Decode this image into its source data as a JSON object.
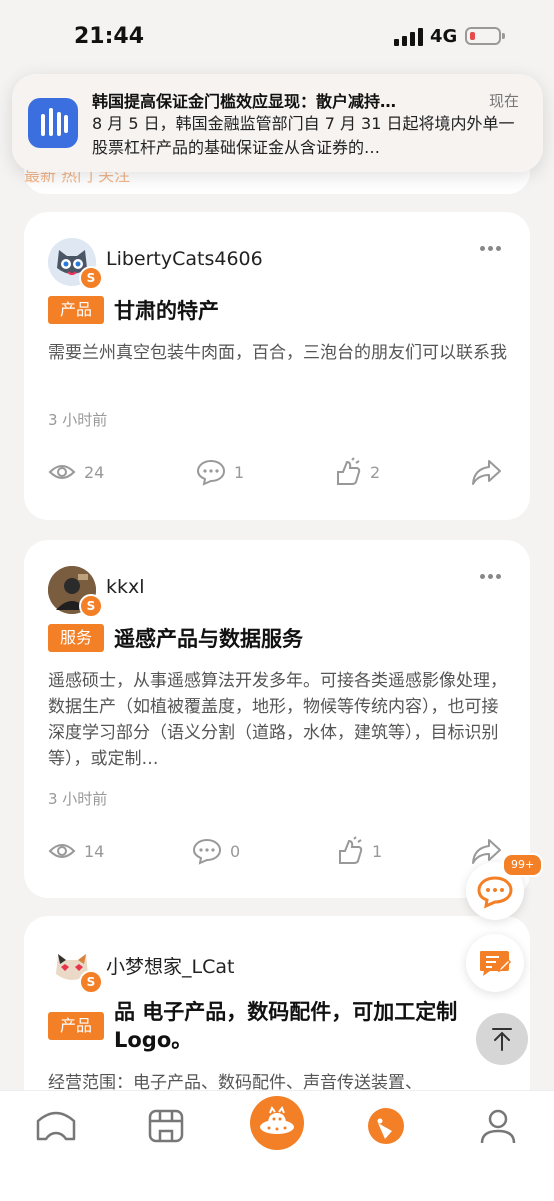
{
  "status": {
    "time": "21:44",
    "network": "4G"
  },
  "underlay": {
    "tabs": "最新  热门  关注"
  },
  "notification": {
    "title": "韩国提高保证金门槛效应显现：散户减持…",
    "time": "现在",
    "body": "8 月 5 日，韩国金融监管部门自 7 月 31 日起将境内外单一股票杠杆产品的基础保证金从含证券的…"
  },
  "posts": [
    {
      "username": "LibertyCats4606",
      "tag": "产品",
      "title": "甘肃的特产",
      "desc": "需要兰州真空包装牛肉面，百合，三泡台的朋友们可以联系我",
      "time": "3 小时前",
      "views": "24",
      "comments": "1",
      "likes": "2"
    },
    {
      "username": "kkxl",
      "tag": "服务",
      "title": "遥感产品与数据服务",
      "desc": "遥感硕士，从事遥感算法开发多年。可接各类遥感影像处理，数据生产（如植被覆盖度，地形，物候等传统内容），也可接深度学习部分（语义分割（道路，水体，建筑等），目标识别等），或定制…",
      "time": "3 小时前",
      "views": "14",
      "comments": "0",
      "likes": "1"
    },
    {
      "username": "小梦想家_LCat",
      "tag": "产品",
      "title": "品 电子产品，数码配件，可加工定制Logo。",
      "desc": "经营范围：电子产品、数码配件、声音传送装置、"
    }
  ],
  "avatar_badge": "S",
  "fab": {
    "message_badge": "99+"
  },
  "colors": {
    "accent": "#f37f26",
    "muted": "#999999"
  },
  "icons": [
    "eye-icon",
    "comment-icon",
    "like-icon",
    "share-icon",
    "chat-bubble-icon",
    "edit-note-icon",
    "arrow-up-icon",
    "home-icon",
    "store-icon",
    "ufo-icon",
    "discover-icon",
    "profile-icon"
  ]
}
